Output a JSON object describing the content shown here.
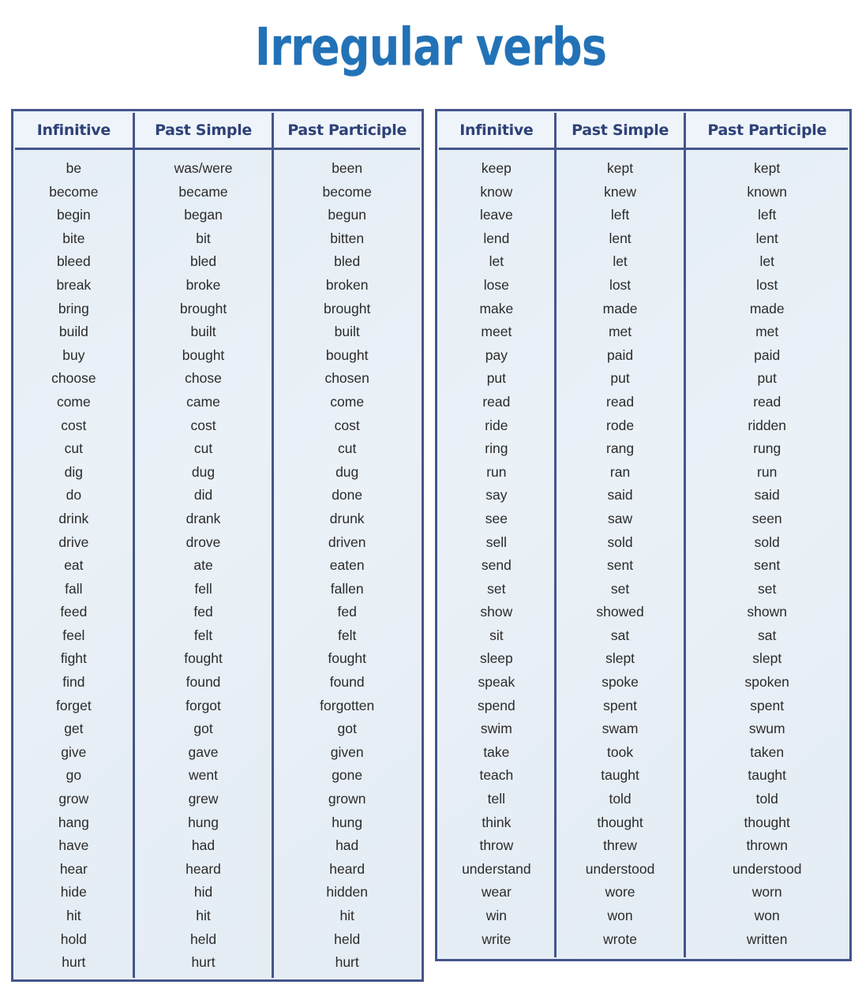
{
  "title": "Irregular verbs",
  "accent_color": "#2272b7",
  "border_color": "#44558c",
  "header_text_color": "#2e4178",
  "cell_background": "#e9f0f6",
  "columns": [
    "Infinitive",
    "Past Simple",
    "Past Participle"
  ],
  "tables": [
    {
      "id": "left",
      "headers": [
        "Infinitive",
        "Past Simple",
        "Past Participle"
      ],
      "rows": [
        [
          "be",
          "was/were",
          "been"
        ],
        [
          "become",
          "became",
          "become"
        ],
        [
          "begin",
          "began",
          "begun"
        ],
        [
          "bite",
          "bit",
          "bitten"
        ],
        [
          "bleed",
          "bled",
          "bled"
        ],
        [
          "break",
          "broke",
          "broken"
        ],
        [
          "bring",
          "brought",
          "brought"
        ],
        [
          "build",
          "built",
          "built"
        ],
        [
          "buy",
          "bought",
          "bought"
        ],
        [
          "choose",
          "chose",
          "chosen"
        ],
        [
          "come",
          "came",
          "come"
        ],
        [
          "cost",
          "cost",
          "cost"
        ],
        [
          "cut",
          "cut",
          "cut"
        ],
        [
          "dig",
          "dug",
          "dug"
        ],
        [
          "do",
          "did",
          "done"
        ],
        [
          "drink",
          "drank",
          "drunk"
        ],
        [
          "drive",
          "drove",
          "driven"
        ],
        [
          "eat",
          "ate",
          "eaten"
        ],
        [
          "fall",
          "fell",
          "fallen"
        ],
        [
          "feed",
          "fed",
          "fed"
        ],
        [
          "feel",
          "felt",
          "felt"
        ],
        [
          "fight",
          "fought",
          "fought"
        ],
        [
          "find",
          "found",
          "found"
        ],
        [
          "forget",
          "forgot",
          "forgotten"
        ],
        [
          "get",
          "got",
          "got"
        ],
        [
          "give",
          "gave",
          "given"
        ],
        [
          "go",
          "went",
          "gone"
        ],
        [
          "grow",
          "grew",
          "grown"
        ],
        [
          "hang",
          "hung",
          "hung"
        ],
        [
          "have",
          "had",
          "had"
        ],
        [
          "hear",
          "heard",
          "heard"
        ],
        [
          "hide",
          "hid",
          "hidden"
        ],
        [
          "hit",
          "hit",
          "hit"
        ],
        [
          "hold",
          "held",
          "held"
        ],
        [
          "hurt",
          "hurt",
          "hurt"
        ]
      ]
    },
    {
      "id": "right",
      "headers": [
        "Infinitive",
        "Past Simple",
        "Past Participle"
      ],
      "rows": [
        [
          "keep",
          "kept",
          "kept"
        ],
        [
          "know",
          "knew",
          "known"
        ],
        [
          "leave",
          "left",
          "left"
        ],
        [
          "lend",
          "lent",
          "lent"
        ],
        [
          "let",
          "let",
          "let"
        ],
        [
          "lose",
          "lost",
          "lost"
        ],
        [
          "make",
          "made",
          "made"
        ],
        [
          "meet",
          "met",
          "met"
        ],
        [
          "pay",
          "paid",
          "paid"
        ],
        [
          "put",
          "put",
          "put"
        ],
        [
          "read",
          "read",
          "read"
        ],
        [
          "ride",
          "rode",
          "ridden"
        ],
        [
          "ring",
          "rang",
          "rung"
        ],
        [
          "run",
          "ran",
          "run"
        ],
        [
          "say",
          "said",
          "said"
        ],
        [
          "see",
          "saw",
          "seen"
        ],
        [
          "sell",
          "sold",
          "sold"
        ],
        [
          "send",
          "sent",
          "sent"
        ],
        [
          "set",
          "set",
          "set"
        ],
        [
          "show",
          "showed",
          "shown"
        ],
        [
          "sit",
          "sat",
          "sat"
        ],
        [
          "sleep",
          "slept",
          "slept"
        ],
        [
          "speak",
          "spoke",
          "spoken"
        ],
        [
          "spend",
          "spent",
          "spent"
        ],
        [
          "swim",
          "swam",
          "swum"
        ],
        [
          "take",
          "took",
          "taken"
        ],
        [
          "teach",
          "taught",
          "taught"
        ],
        [
          "tell",
          "told",
          "told"
        ],
        [
          "think",
          "thought",
          "thought"
        ],
        [
          "throw",
          "threw",
          "thrown"
        ],
        [
          "understand",
          "understood",
          "understood"
        ],
        [
          "wear",
          "wore",
          "worn"
        ],
        [
          "win",
          "won",
          "won"
        ],
        [
          "write",
          "wrote",
          "written"
        ]
      ]
    }
  ]
}
